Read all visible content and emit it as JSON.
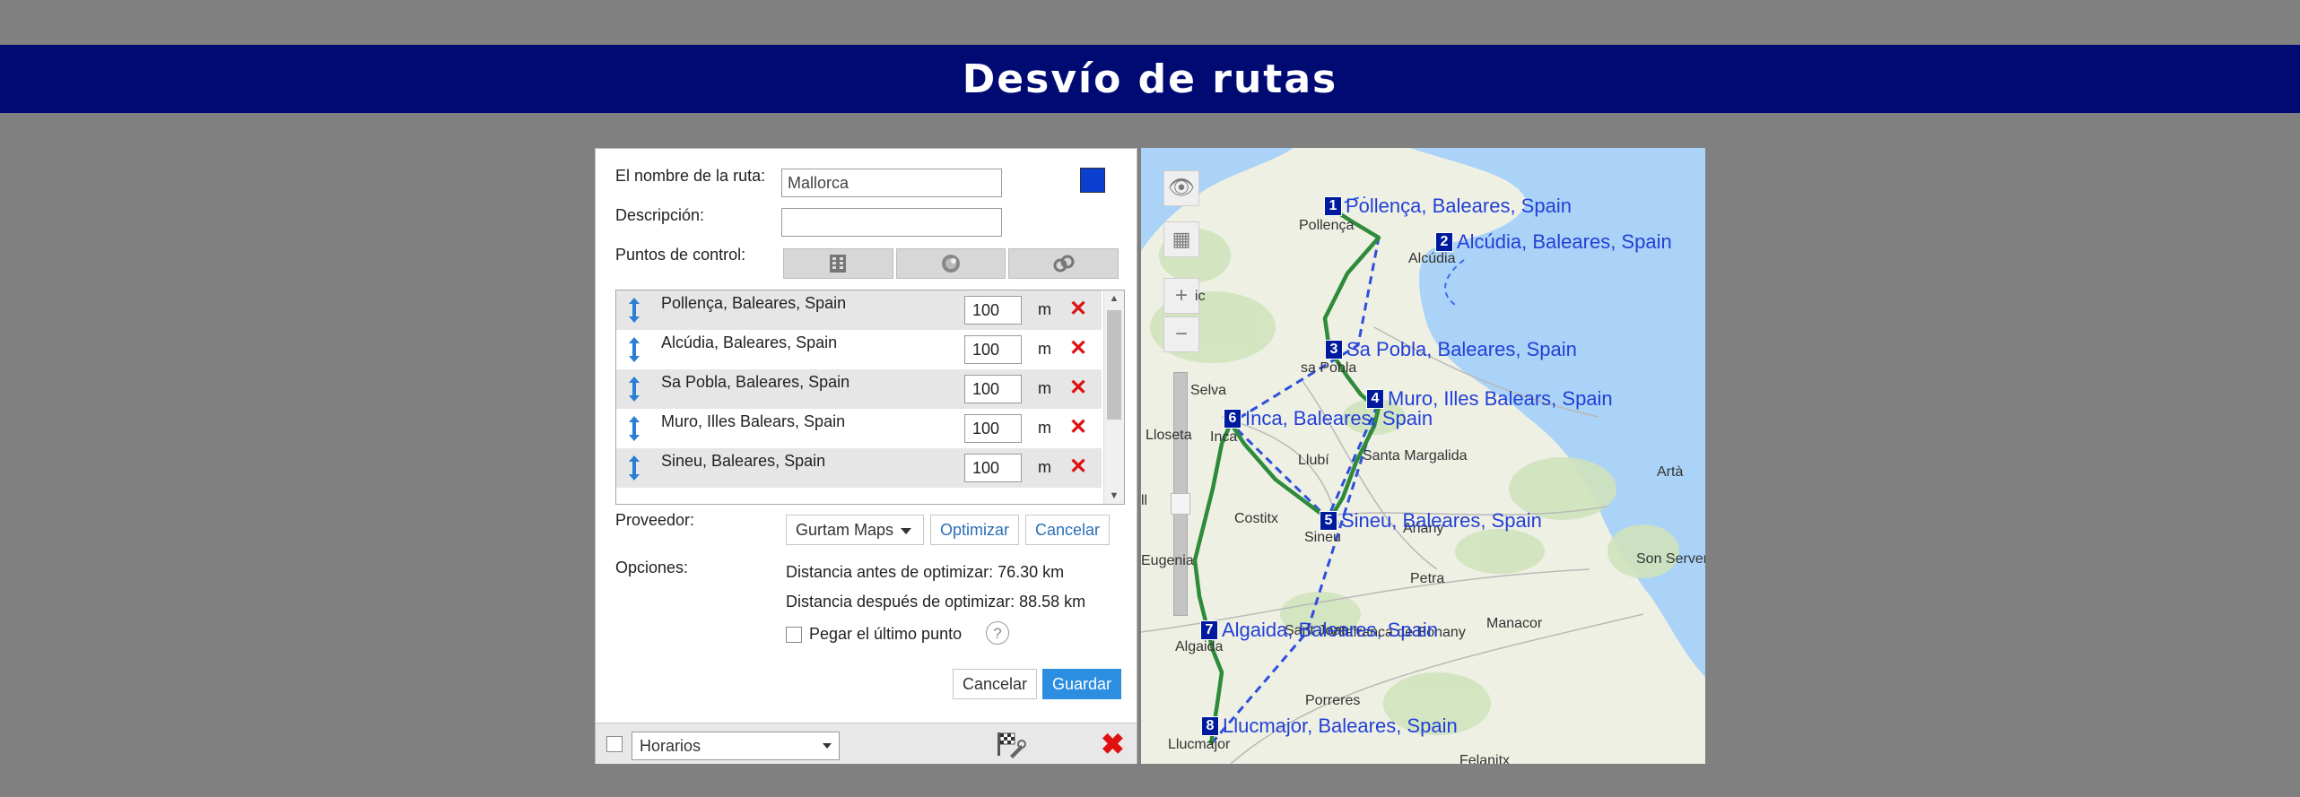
{
  "window": {
    "title": "Desvío de rutas"
  },
  "form": {
    "route_name_label": "El nombre de la ruta:",
    "route_name_value": "Mallorca",
    "route_color": "#0b3fd0",
    "description_label": "Descripción:",
    "description_value": "",
    "control_points_label": "Puntos de control:",
    "control_point_tools": [
      "list-icon",
      "add-point-icon",
      "chain-icon"
    ]
  },
  "points": [
    {
      "name": "Pollença, Baleares, Spain",
      "radius": "100",
      "unit": "m"
    },
    {
      "name": "Alcúdia, Baleares, Spain",
      "radius": "100",
      "unit": "m"
    },
    {
      "name": "Sa Pobla, Baleares, Spain",
      "radius": "100",
      "unit": "m"
    },
    {
      "name": "Muro, Illes Balears, Spain",
      "radius": "100",
      "unit": "m"
    },
    {
      "name": "Sineu, Baleares, Spain",
      "radius": "100",
      "unit": "m"
    }
  ],
  "provider": {
    "label": "Proveedor:",
    "selected": "Gurtam Maps",
    "optimize_label": "Optimizar",
    "cancel_label": "Cancelar"
  },
  "options": {
    "label": "Opciones:",
    "distance_before": "Distancia antes de optimizar: 76.30 km",
    "distance_after": "Distancia después de optimizar: 88.58 km",
    "stick_last_label": "Pegar el último punto",
    "stick_last_checked": false
  },
  "actions": {
    "cancel_label": "Cancelar",
    "save_label": "Guardar"
  },
  "footer": {
    "schedule_selected": "Horarios",
    "schedule_checked": false
  },
  "map": {
    "accent": "#2340d6",
    "route_color": "#2e8b3a",
    "waypoints": [
      {
        "n": "1",
        "label": "Pollença, Baleares, Spain"
      },
      {
        "n": "2",
        "label": "Alcúdia, Baleares, Spain"
      },
      {
        "n": "3",
        "label": "Sa Pobla, Baleares, Spain"
      },
      {
        "n": "4",
        "label": "Muro, Illes Balears, Spain"
      },
      {
        "n": "5",
        "label": "Sineu, Baleares, Spain"
      },
      {
        "n": "6",
        "label": "Inca, Baleares, Spain"
      },
      {
        "n": "7",
        "label": "Algaida, Baleares, Spain"
      },
      {
        "n": "8",
        "label": "Llucmajor, Baleares, Spain"
      }
    ],
    "towns": [
      "Pollença",
      "Alcúdia",
      "sa Pobla",
      "Selva",
      "Lloseta",
      "Inca",
      "Llubí",
      "Santa Margalida",
      "Costitx",
      "Sineu",
      "Ariany",
      "Artà",
      "Son Servera",
      "Petra",
      "Eugenia",
      "Manacor",
      "Algaida",
      "Porreres",
      "Llucmajor",
      "Sant Joan",
      "Vilafranca de Bonany",
      "ic",
      "ll",
      "Felanitx"
    ]
  }
}
